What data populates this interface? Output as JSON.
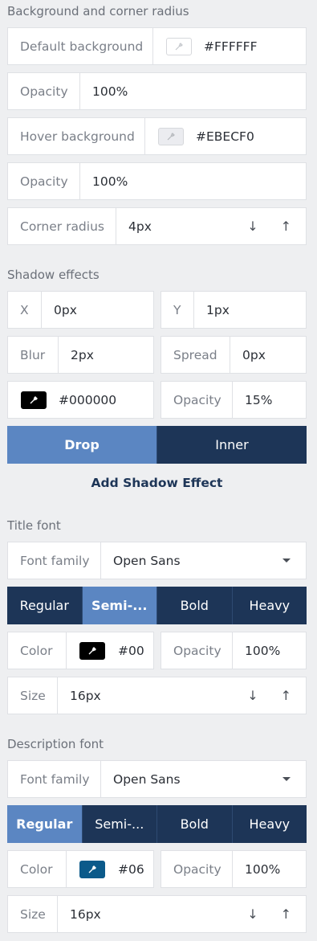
{
  "background_section": {
    "title": "Background and corner radius",
    "default_background": {
      "label": "Default background",
      "value": "#FFFFFF"
    },
    "default_opacity": {
      "label": "Opacity",
      "value": "100%"
    },
    "hover_background": {
      "label": "Hover background",
      "value": "#EBECF0"
    },
    "hover_opacity": {
      "label": "Opacity",
      "value": "100%"
    },
    "corner_radius": {
      "label": "Corner radius",
      "value": "4px"
    }
  },
  "shadow_section": {
    "title": "Shadow effects",
    "x": {
      "label": "X",
      "value": "0px"
    },
    "y": {
      "label": "Y",
      "value": "1px"
    },
    "blur": {
      "label": "Blur",
      "value": "2px"
    },
    "spread": {
      "label": "Spread",
      "value": "0px"
    },
    "color": {
      "value": "#000000"
    },
    "opacity": {
      "label": "Opacity",
      "value": "15%"
    },
    "types": [
      "Drop",
      "Inner"
    ],
    "active_type": "Drop",
    "add_label": "Add Shadow Effect"
  },
  "title_font": {
    "title": "Title font",
    "family": {
      "label": "Font family",
      "value": "Open Sans"
    },
    "weights": [
      "Regular",
      "Semi-...",
      "Bold",
      "Heavy"
    ],
    "active_weight": "Semi-...",
    "color": {
      "label": "Color",
      "value": "#00"
    },
    "opacity": {
      "label": "Opacity",
      "value": "100%"
    },
    "size": {
      "label": "Size",
      "value": "16px"
    }
  },
  "description_font": {
    "title": "Description font",
    "family": {
      "label": "Font family",
      "value": "Open Sans"
    },
    "weights": [
      "Regular",
      "Semi-...",
      "Bold",
      "Heavy"
    ],
    "active_weight": "Regular",
    "color": {
      "label": "Color",
      "value": "#06"
    },
    "opacity": {
      "label": "Opacity",
      "value": "100%"
    },
    "size": {
      "label": "Size",
      "value": "16px"
    }
  },
  "colors": {
    "accent_dark": "#1D3557",
    "accent_active": "#5B86C2",
    "title_font_swatch": "#000000",
    "description_font_swatch": "#0B5A8A"
  },
  "icons": {
    "arrow_down": "↓",
    "arrow_up": "↑",
    "eyedropper": "eyedropper-icon",
    "dropdown": "chevron-down-icon"
  }
}
